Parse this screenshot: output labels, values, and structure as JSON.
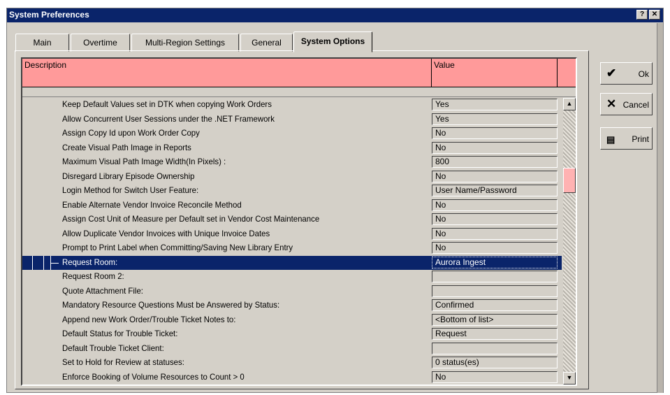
{
  "window": {
    "title": "System Preferences",
    "help_label": "?",
    "close_label": "✕"
  },
  "tabs": [
    {
      "label": "Main"
    },
    {
      "label": "Overtime"
    },
    {
      "label": "Multi-Region Settings"
    },
    {
      "label": "General"
    },
    {
      "label": "System Options",
      "active": true
    }
  ],
  "grid": {
    "columns": {
      "description": "Description",
      "value": "Value"
    },
    "rows": [
      {
        "description": "Keep Default Values set in DTK when copying Work Orders",
        "value": "Yes"
      },
      {
        "description": "Allow Concurrent User Sessions under the .NET Framework",
        "value": "Yes"
      },
      {
        "description": "Assign Copy Id upon Work Order Copy",
        "value": "No"
      },
      {
        "description": "Create Visual Path Image in Reports",
        "value": "No"
      },
      {
        "description": "Maximum Visual Path Image Width(In Pixels) :",
        "value": "800"
      },
      {
        "description": "Disregard Library Episode Ownership",
        "value": "No"
      },
      {
        "description": "Login Method for Switch User Feature:",
        "value": "User Name/Password"
      },
      {
        "description": "Enable Alternate Vendor Invoice Reconcile Method",
        "value": "No"
      },
      {
        "description": "Assign Cost Unit of Measure per Default set in Vendor Cost Maintenance",
        "value": "No"
      },
      {
        "description": "Allow Duplicate Vendor Invoices with Unique Invoice Dates",
        "value": "No"
      },
      {
        "description": "Prompt to Print Label when Committing/Saving New Library Entry",
        "value": "No"
      },
      {
        "description": "Request Room:",
        "value": "Aurora Ingest",
        "selected": true
      },
      {
        "description": "Request Room 2:",
        "value": ""
      },
      {
        "description": "Quote Attachment File:",
        "value": ""
      },
      {
        "description": "Mandatory Resource Questions Must be Answered by Status:",
        "value": "Confirmed"
      },
      {
        "description": "Append new Work Order/Trouble Ticket Notes to:",
        "value": "<Bottom of list>"
      },
      {
        "description": "Default Status for Trouble Ticket:",
        "value": "Request"
      },
      {
        "description": "Default Trouble Ticket Client:",
        "value": ""
      },
      {
        "description": "Set to Hold for Review at statuses:",
        "value": "0 status(es)"
      },
      {
        "description": "Enforce Booking of Volume Resources to Count > 0",
        "value": "No"
      }
    ]
  },
  "scrollbar": {
    "up_icon": "scroll-up-arrow-icon",
    "down_icon": "scroll-down-arrow-icon"
  },
  "buttons": {
    "ok": {
      "label": "Ok",
      "icon": "checkmark-icon"
    },
    "cancel": {
      "label": "Cancel",
      "icon": "x-icon"
    },
    "print": {
      "label": "Print",
      "icon": "printer-icon"
    }
  },
  "colors": {
    "header_pink": "#ff9a9a",
    "selection": "#0a246a",
    "titlebar": "#0a246a"
  }
}
